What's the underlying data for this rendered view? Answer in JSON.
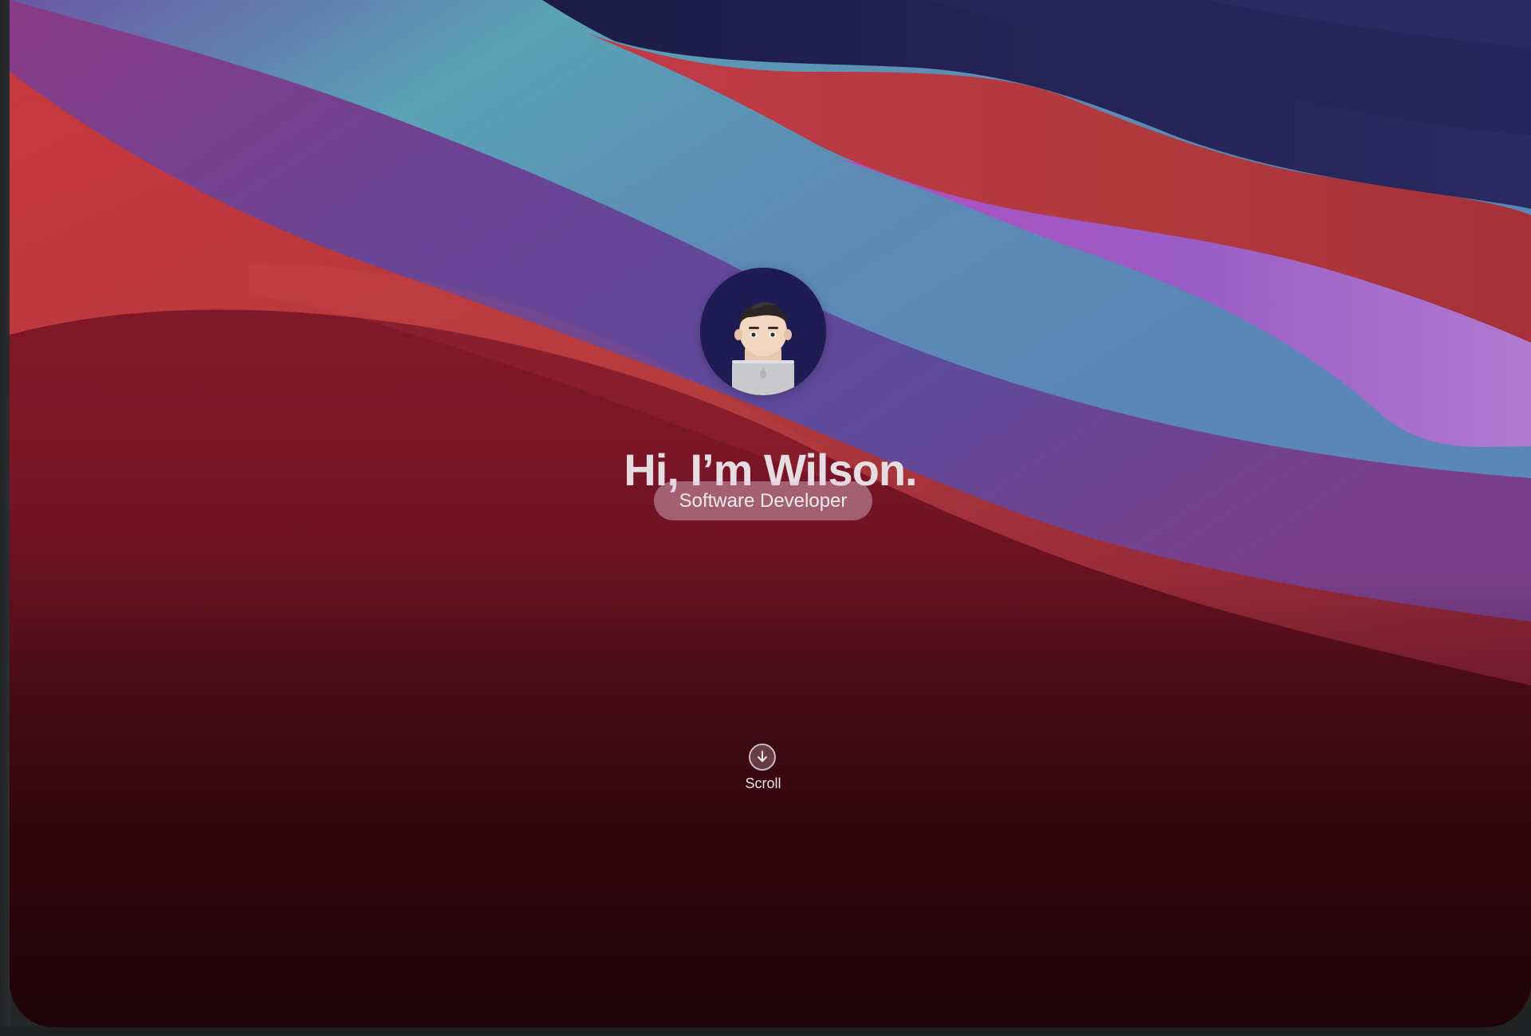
{
  "hero": {
    "greeting": "Hi, I’m Wilson.",
    "role": "Software Developer",
    "avatar_description_icon": "memoji-avatar-icon"
  },
  "scroll": {
    "label": "Scroll",
    "icon": "arrow-down-circle-icon"
  },
  "colors": {
    "wallpaper_navy": "#1f1f4c",
    "wallpaper_red": "#b23a3c",
    "wallpaper_teal": "#5aa2b6",
    "wallpaper_purple": "#9a5cc6",
    "wallpaper_dark": "#2a0810",
    "avatar_background": "#1e1c52"
  }
}
